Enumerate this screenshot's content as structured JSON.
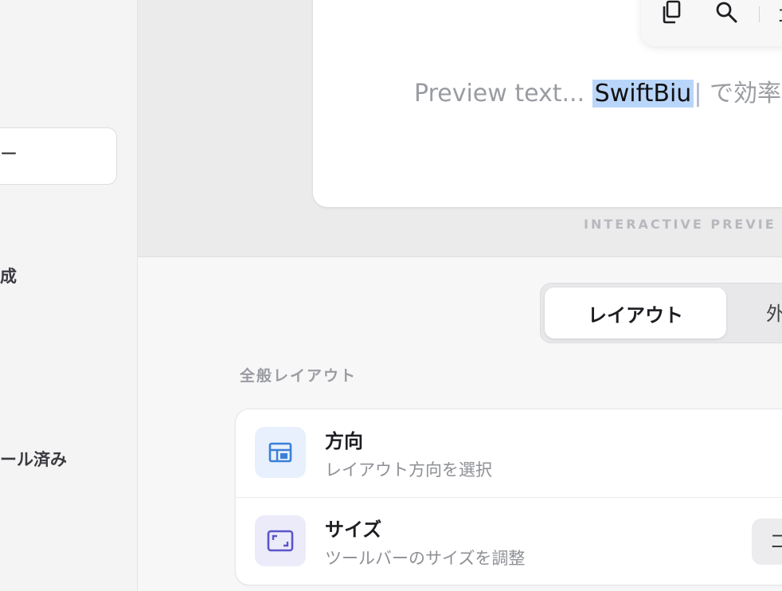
{
  "sidebar": {
    "search_text": "ー",
    "items": [
      {
        "label": "成"
      },
      {
        "label": "ール済み"
      }
    ]
  },
  "preview": {
    "text_before": "Preview text... ",
    "selected_text": "SwiftBiu",
    "caret": "|",
    "text_after": " で効率",
    "caption": "INTERACTIVE PREVIE",
    "toolbar": {
      "icons": [
        "copy-icon",
        "search-icon"
      ],
      "more_label": "コ"
    }
  },
  "tabs": {
    "active_label": "レイアウト",
    "other_label": "外"
  },
  "section": {
    "title": "全般レイアウト",
    "rows": [
      {
        "title": "方向",
        "subtitle": "レイアウト方向を選択",
        "icon": "layout-icon",
        "icon_color": "#3b7fd9",
        "icon_bg": "#e7f0fc"
      },
      {
        "title": "サイズ",
        "subtitle": "ツールバーのサイズを調整",
        "icon": "resize-icon",
        "icon_color": "#5a55c9",
        "icon_bg": "#ecebfa",
        "control_label": "コ"
      }
    ]
  },
  "colors": {
    "selection": "#b9d6fa",
    "accent_blue": "#3b7fd9",
    "accent_purple": "#5a55c9"
  }
}
